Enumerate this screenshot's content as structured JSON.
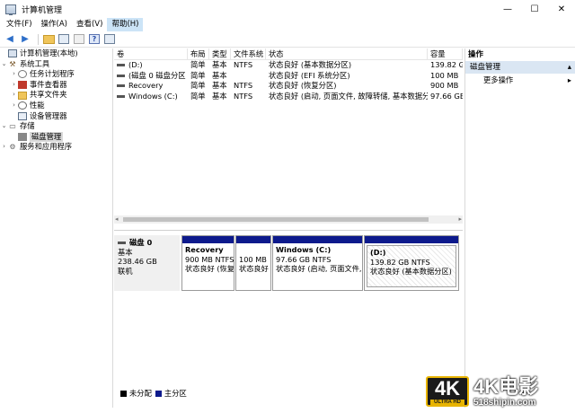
{
  "window": {
    "title": "计算机管理",
    "controls": [
      "—",
      "☐",
      "✕"
    ]
  },
  "menu": [
    "文件(F)",
    "操作(A)",
    "查看(V)",
    "帮助(H)"
  ],
  "tree": {
    "root": "计算机管理(本地)",
    "system_tools": "系统工具",
    "task_scheduler": "任务计划程序",
    "event_viewer": "事件查看器",
    "shared_folders": "共享文件夹",
    "performance": "性能",
    "device_manager": "设备管理器",
    "storage": "存储",
    "disk_management": "磁盘管理",
    "services": "服务和应用程序"
  },
  "volume_table": {
    "headers": [
      "卷",
      "布局",
      "类型",
      "文件系统",
      "状态",
      "容量"
    ],
    "rows": [
      [
        "(D:)",
        "简单",
        "基本",
        "NTFS",
        "状态良好 (基本数据分区)",
        "139.82 G"
      ],
      [
        "(磁盘 0 磁盘分区 2)",
        "简单",
        "基本",
        "",
        "状态良好 (EFI 系统分区)",
        "100 MB"
      ],
      [
        "Recovery",
        "简单",
        "基本",
        "NTFS",
        "状态良好 (恢复分区)",
        "900 MB"
      ],
      [
        "Windows (C:)",
        "简单",
        "基本",
        "NTFS",
        "状态良好 (启动, 页面文件, 故障转储, 基本数据分区)",
        "97.66 GB"
      ]
    ]
  },
  "disk": {
    "name": "磁盘 0",
    "type": "基本",
    "size": "238.46 GB",
    "status": "联机"
  },
  "partitions": [
    {
      "name": "Recovery",
      "size": "900 MB NTFS",
      "status": "状态良好 (恢复"
    },
    {
      "name": "",
      "size": "100 MB",
      "status": "状态良好"
    },
    {
      "name": "Windows  (C:)",
      "size": "97.66 GB NTFS",
      "status": "状态良好 (启动, 页面文件, 故"
    },
    {
      "name": "(D:)",
      "size": "139.82 GB NTFS",
      "status": "状态良好 (基本数据分区)"
    }
  ],
  "legend": {
    "unallocated": "未分配",
    "primary": "主分区",
    "unallocated_color": "#000000",
    "primary_color": "#0d1a8c"
  },
  "actions": {
    "header": "操作",
    "section": "磁盘管理",
    "more": "更多操作"
  },
  "watermark": {
    "logo": "4K",
    "logo_sub": "ULTRA HD",
    "brand": "4K电影",
    "site": "518shipin.com"
  }
}
